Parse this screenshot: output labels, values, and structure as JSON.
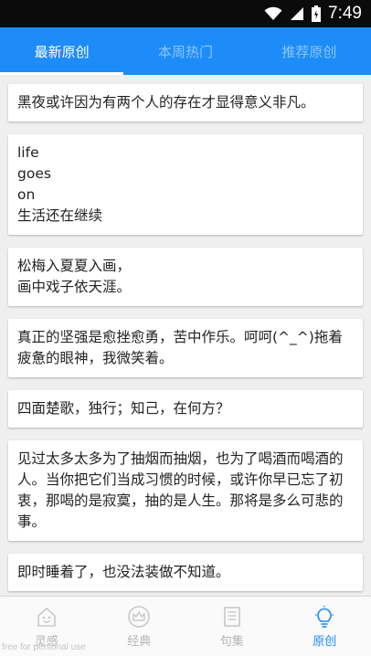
{
  "status_bar": {
    "time": "7:49"
  },
  "tabs": [
    {
      "label": "最新原创",
      "active": true
    },
    {
      "label": "本周热门",
      "active": false
    },
    {
      "label": "推荐原创",
      "active": false
    }
  ],
  "cards": [
    {
      "text": "黑夜或许因为有两个人的存在才显得意义非凡。"
    },
    {
      "text": "life\ngoes\non\n生活还在继续"
    },
    {
      "text": "松梅入夏夏入画，\n画中戏子依天涯。"
    },
    {
      "text": "真正的坚强是愈挫愈勇，苦中作乐。呵呵(^_^)拖着疲惫的眼神，我微笑着。"
    },
    {
      "text": "四面楚歌，独行；知己，在何方？"
    },
    {
      "text": "见过太多太多为了抽烟而抽烟，也为了喝酒而喝酒的人。当你把它们当成习惯的时候，或许你早已忘了初衷，那喝的是寂寞，抽的是人生。那将是多么可悲的事。"
    },
    {
      "text": "即时睡着了，也没法装做不知道。"
    }
  ],
  "bottom_nav": [
    {
      "label": "灵感",
      "icon": "inspiration-icon",
      "active": false
    },
    {
      "label": "经典",
      "icon": "crown-icon",
      "active": false
    },
    {
      "label": "句集",
      "icon": "document-icon",
      "active": false
    },
    {
      "label": "原创",
      "icon": "lightbulb-icon",
      "active": true
    }
  ],
  "watermark": "free for personal use",
  "colors": {
    "accent": "#1d8cf8",
    "inactive_tab": "#8cc6ff",
    "nav_inactive": "#b5b5b5"
  }
}
